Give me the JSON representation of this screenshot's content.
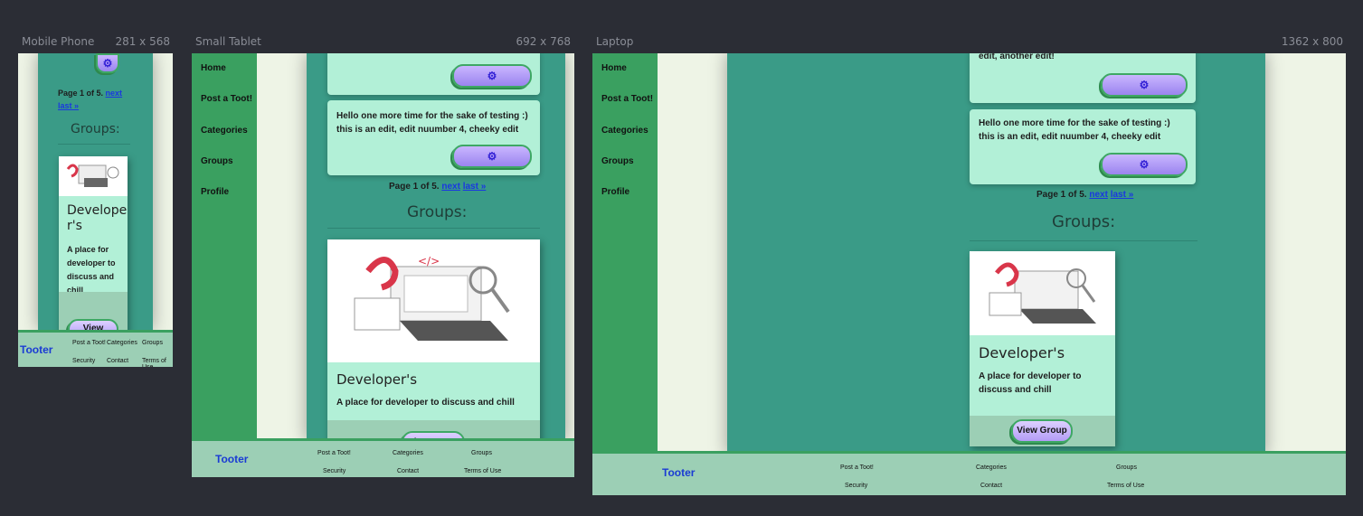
{
  "devices": {
    "mobile": {
      "name": "Mobile Phone",
      "size": "281 x 568"
    },
    "tablet": {
      "name": "Small Tablet",
      "size": "692 x 768"
    },
    "laptop": {
      "name": "Laptop",
      "size": "1362 x 800"
    }
  },
  "nav": {
    "home": "Home",
    "post": "Post a Toot!",
    "categories": "Categories",
    "groups": "Groups",
    "profile": "Profile"
  },
  "toots": {
    "laptop_partial": "edit, another edit!",
    "testing": "Hello one more time for the sake of testing :) this is an edit, edit nuumber 4, cheeky edit"
  },
  "pager": {
    "text": "Page 1 of 5.",
    "next": "next",
    "last": "last »"
  },
  "groups": {
    "heading": "Groups:",
    "card_title": "Developer's",
    "card_title_mobile_1": "Develope",
    "card_title_mobile_2": "r's",
    "card_desc": "A place for developer to discuss and chill",
    "view_button": "View Group",
    "mobile_view_button": "View"
  },
  "footer": {
    "brand": "Tooter",
    "post": "Post a Toot!",
    "categories": "Categories",
    "groups": "Groups",
    "security": "Security",
    "contact": "Contact",
    "terms": "Terms of Use"
  },
  "colors": {
    "teal": "#3a9b87",
    "green": "#3aa060",
    "card": "#b2f0d7",
    "footer": "#9ccfb5",
    "brand": "#1a3bd4"
  },
  "icons": {
    "toot_button": "settings-icon"
  }
}
